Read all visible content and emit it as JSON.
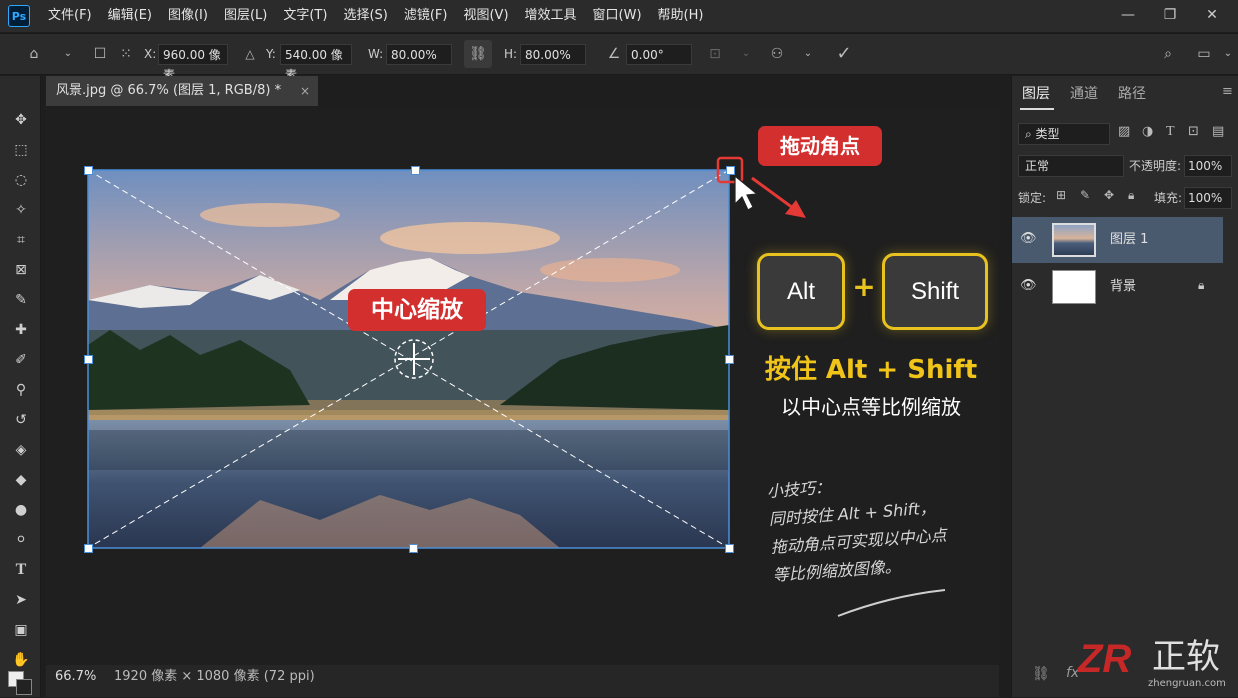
{
  "app": {
    "logo": "Ps"
  },
  "menu": [
    "文件(F)",
    "编辑(E)",
    "图像(I)",
    "图层(L)",
    "文字(T)",
    "选择(S)",
    "滤镜(F)",
    "视图(V)",
    "增效工具",
    "窗口(W)",
    "帮助(H)"
  ],
  "window_controls": {
    "minimize_icon": "minimize-icon",
    "restore_icon": "restore-icon",
    "close_icon": "close-icon"
  },
  "options": {
    "x_label": "X:",
    "x_value": "960.00 像素",
    "y_label": "Y:",
    "y_value": "540.00 像素",
    "w_label": "W:",
    "w_value": "80.00%",
    "h_label": "H:",
    "h_value": "80.00%",
    "angle_value": "0.00°"
  },
  "document": {
    "tab_title": "风景.jpg @ 66.7% (图层 1, RGB/8) *",
    "close": "×"
  },
  "status": {
    "zoom": "66.7%",
    "info": "1920 像素 × 1080 像素 (72 ppi)"
  },
  "panel": {
    "tabs": [
      "图层",
      "通道",
      "路径"
    ],
    "filter_kind": "类型",
    "blend_mode": "正常",
    "opacity_label": "不透明度:",
    "opacity_value": "100%",
    "lock_label": "锁定:",
    "fill_label": "填充:",
    "fill_value": "100%",
    "layers": [
      {
        "name": "图层 1",
        "selected": true
      },
      {
        "name": "背景",
        "selected": false,
        "locked": true
      }
    ]
  },
  "overlay": {
    "drag_corner_label": "拖动角点",
    "center_scale_label": "中心缩放",
    "key_alt": "Alt",
    "key_plus": "+",
    "key_shift": "Shift",
    "hold_text": "按住 Alt + Shift",
    "hold_sub": "以中心点等比例缩放",
    "tip_lines": [
      "小技巧：",
      "同时按住 Alt + Shift，",
      "拖动角点可实现以中心点",
      "等比例缩放图像。"
    ]
  },
  "watermark": {
    "brand": "正软",
    "url": "zhengruan.com"
  },
  "colors": {
    "accent": "#4a8fd8",
    "callout_red": "#d32f2f",
    "key_yellow": "#e8c21f"
  }
}
